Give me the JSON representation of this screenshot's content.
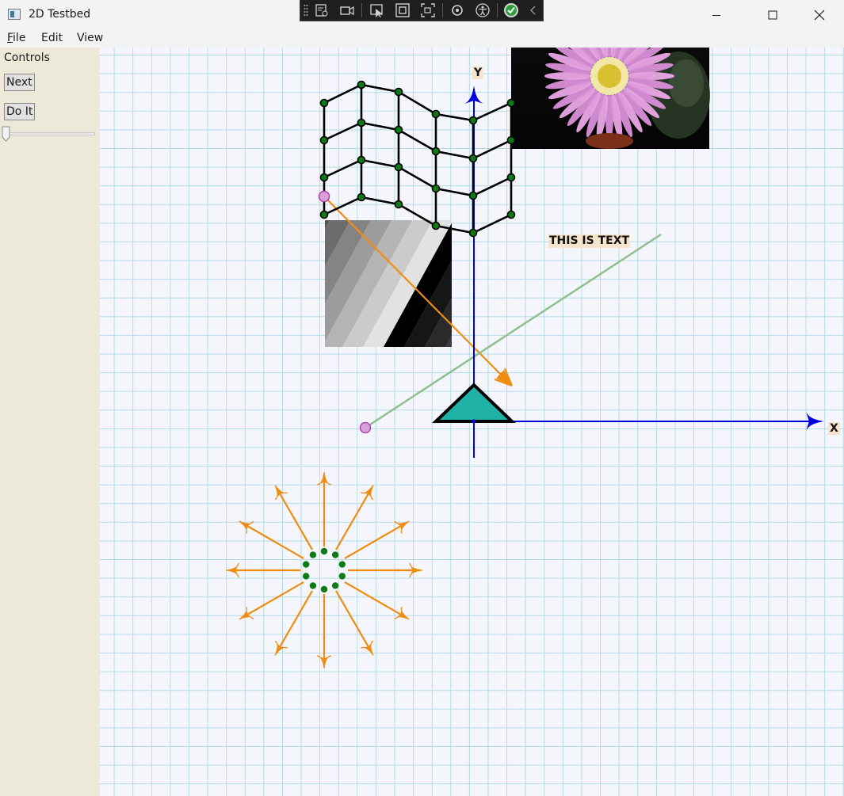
{
  "window": {
    "title": "2D Testbed",
    "icon": "app-window-icon",
    "buttons": [
      "minimize-icon",
      "maximize-icon",
      "close-icon"
    ]
  },
  "devtools": {
    "icons": [
      "visual-tree-icon",
      "record-icon",
      "select-element-icon",
      "display-layout-adorner-icon",
      "track-focus-icon",
      "hot-reload-icon",
      "accessibility-icon",
      "binding-check-icon",
      "collapse-chevron-icon"
    ]
  },
  "menu": {
    "file": "File",
    "edit": "Edit",
    "view": "View"
  },
  "sidebar": {
    "controls_label": "Controls",
    "next_label": "Next",
    "doit_label": "Do It",
    "slider_value": 0
  },
  "canvas": {
    "x_axis_label": "X",
    "y_axis_label": "Y",
    "text_label": "THIS IS TEXT",
    "colors": {
      "background": "#f4f6fb",
      "grid": "#b3dbe8",
      "axis": "#0000dd",
      "arrow": "#f08c10",
      "triangle_fill": "#20b2a6",
      "mesh": "#000000",
      "vertex": "#0e7a14",
      "line": "#8fc08f",
      "handle": "#c04cc0"
    }
  }
}
